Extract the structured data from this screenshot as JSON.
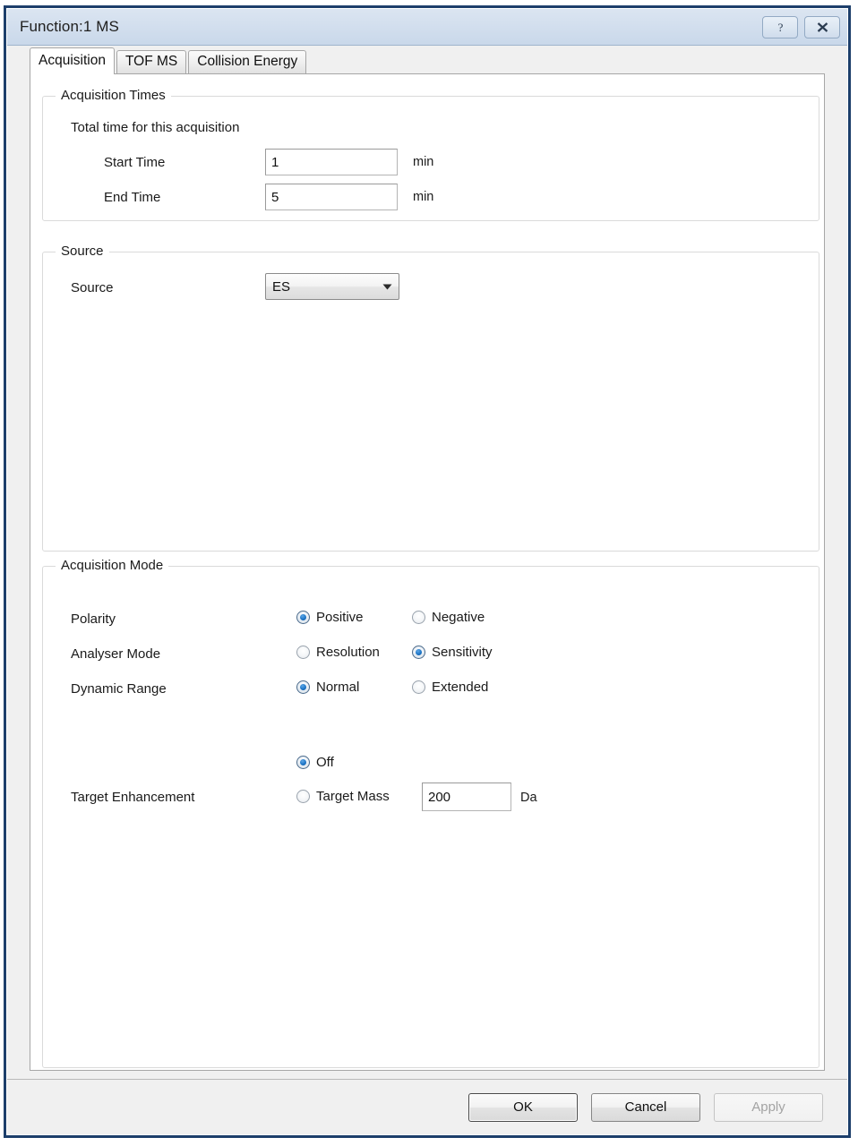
{
  "window": {
    "title": "Function:1 MS",
    "help_icon": "question-mark-icon",
    "close_icon": "close-icon",
    "border_color": "#1d3f6b",
    "titlebar_color": "#d3dfee"
  },
  "tabs": [
    {
      "label": "Acquisition",
      "active": true
    },
    {
      "label": "TOF MS",
      "active": false
    },
    {
      "label": "Collision Energy",
      "active": false
    }
  ],
  "acquisition_times": {
    "group_title": "Acquisition Times",
    "subtitle": "Total time for this acquisition",
    "start_time": {
      "label": "Start Time",
      "value": "1",
      "unit": "min"
    },
    "end_time": {
      "label": "End Time",
      "value": "5",
      "unit": "min"
    }
  },
  "source": {
    "group_title": "Source",
    "label": "Source",
    "value": "ES",
    "options": [
      "ES"
    ],
    "arrow_icon": "chevron-down-icon"
  },
  "acquisition_mode": {
    "group_title": "Acquisition Mode",
    "polarity": {
      "label": "Polarity",
      "options": [
        {
          "label": "Positive",
          "checked": true
        },
        {
          "label": "Negative",
          "checked": false
        }
      ]
    },
    "analyser_mode": {
      "label": "Analyser Mode",
      "options": [
        {
          "label": "Resolution",
          "checked": false
        },
        {
          "label": "Sensitivity",
          "checked": true
        }
      ]
    },
    "dynamic_range": {
      "label": "Dynamic Range",
      "options": [
        {
          "label": "Normal",
          "checked": true
        },
        {
          "label": "Extended",
          "checked": false
        }
      ]
    },
    "target_enhancement": {
      "label": "Target Enhancement",
      "options": [
        {
          "label": "Off",
          "checked": true
        },
        {
          "label": "Target Mass",
          "checked": false
        }
      ],
      "target_mass_value": "200",
      "target_mass_unit": "Da"
    }
  },
  "footer": {
    "ok_label": "OK",
    "cancel_label": "Cancel",
    "apply_label": "Apply",
    "apply_enabled": false
  }
}
